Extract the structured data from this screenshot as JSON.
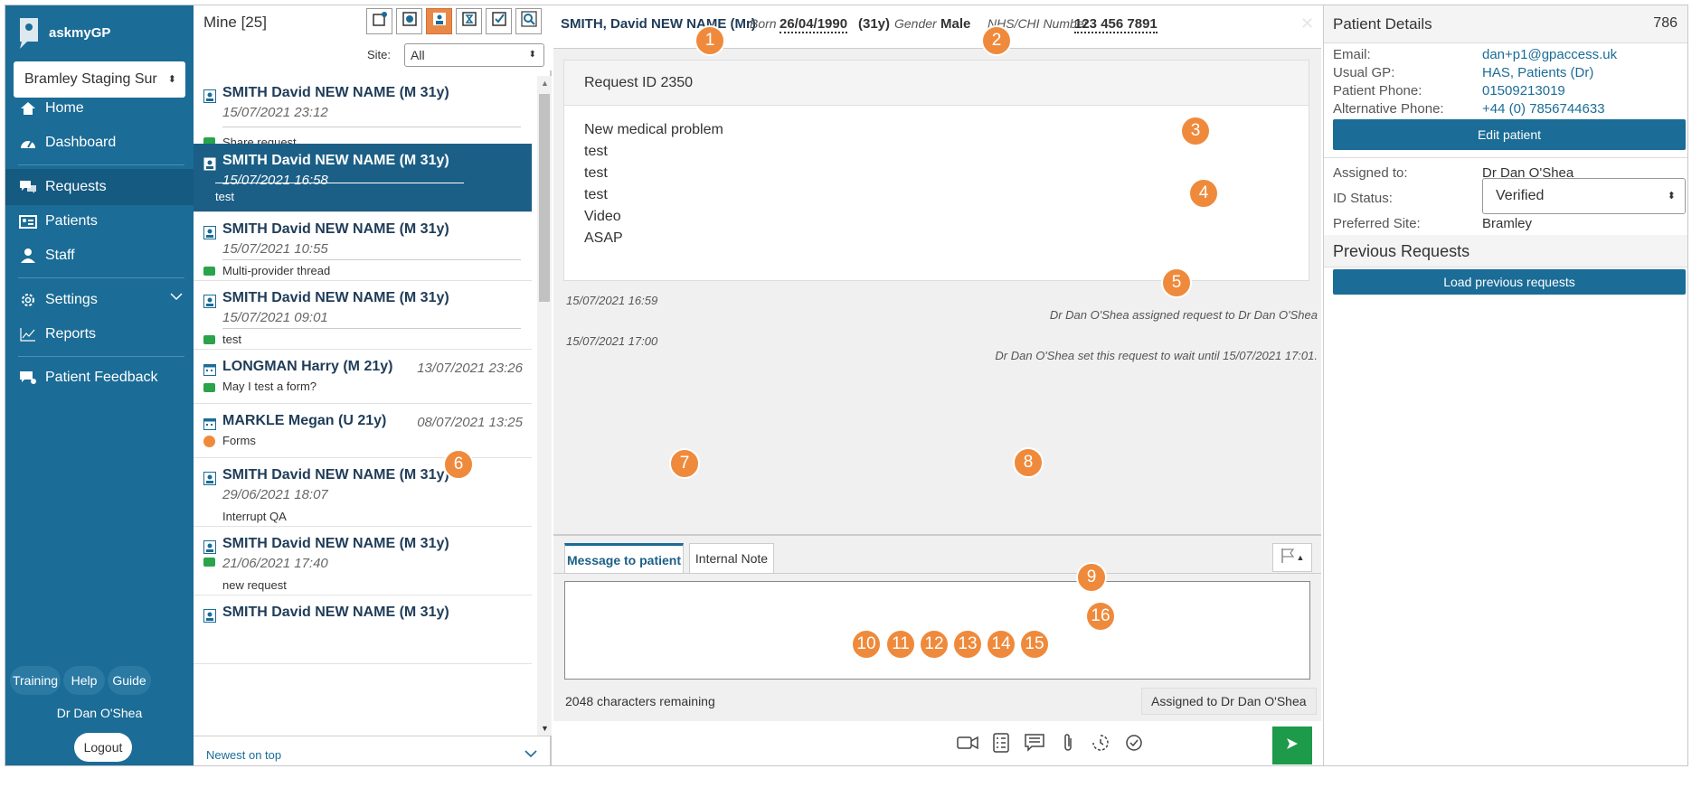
{
  "sidebar": {
    "app_name": "askmyGP",
    "org": "Bramley Staging Sur",
    "nav": {
      "home": "Home",
      "dashboard": "Dashboard",
      "requests": "Requests",
      "patients": "Patients",
      "staff": "Staff",
      "settings": "Settings",
      "reports": "Reports",
      "feedback": "Patient Feedback"
    },
    "training": "Training",
    "help": "Help",
    "guide": "Guide",
    "user": "Dr Dan O'Shea",
    "logout": "Logout"
  },
  "list": {
    "title": "Mine [25]",
    "site_label": "Site:",
    "site_value": "All",
    "items": [
      {
        "name": "SMITH David NEW NAME (M 31y)",
        "date": "15/07/2021 23:12",
        "snippet": "Share request"
      },
      {
        "name": "SMITH David NEW NAME (M 31y)",
        "date": "15/07/2021 16:58",
        "snippet": "test"
      },
      {
        "name": "SMITH David NEW NAME (M 31y)",
        "date": "15/07/2021 10:55",
        "snippet": "Multi-provider thread"
      },
      {
        "name": "SMITH David NEW NAME (M 31y)",
        "date": "15/07/2021 09:01",
        "snippet": "test"
      },
      {
        "name": "LONGMAN Harry (M 21y)",
        "date": "13/07/2021 23:26",
        "snippet": "May I test a form?"
      },
      {
        "name": "MARKLE Megan (U 21y)",
        "date": "08/07/2021 13:25",
        "snippet": "Forms"
      },
      {
        "name": "SMITH David NEW NAME (M 31y)",
        "date": "29/06/2021 18:07",
        "snippet": "Interrupt QA"
      },
      {
        "name": "SMITH David NEW NAME (M 31y)",
        "date": "21/06/2021 17:40",
        "snippet": "new request"
      },
      {
        "name": "SMITH David NEW NAME (M 31y)",
        "date": "",
        "snippet": ""
      }
    ],
    "sort": "Newest on top"
  },
  "patient": {
    "name": "SMITH, David NEW NAME (Mr)",
    "born_label": "Born",
    "born": "26/04/1990",
    "age": "(31y)",
    "gender_label": "Gender",
    "gender": "Male",
    "nhs_label": "NHS/CHI Number",
    "nhs": "123 456 7891"
  },
  "request": {
    "id": "Request ID 2350",
    "lines": [
      "New medical problem",
      "test",
      "test",
      "test",
      "Video",
      "ASAP"
    ],
    "log": [
      {
        "time": "15/07/2021 16:59",
        "text": "Dr Dan O'Shea assigned request to Dr Dan O'Shea"
      },
      {
        "time": "15/07/2021 17:00",
        "text": "Dr Dan O'Shea set this request to wait until 15/07/2021 17:01."
      }
    ]
  },
  "compose": {
    "tab_message": "Message to patient",
    "tab_note": "Internal Note",
    "remaining": "2048 characters remaining",
    "assigned": "Assigned to Dr Dan O'Shea"
  },
  "details": {
    "title": "Patient Details",
    "count": "786",
    "email_label": "Email:",
    "email": "dan+p1@gpaccess.uk",
    "gp_label": "Usual GP:",
    "gp": "HAS, Patients (Dr)",
    "phone_label": "Patient Phone:",
    "phone": "01509213019",
    "alt_label": "Alternative Phone:",
    "alt": "+44 (0) 7856744633",
    "edit": "Edit patient",
    "assigned_label": "Assigned to:",
    "assigned": "Dr Dan O'Shea",
    "id_label": "ID Status:",
    "id_status": "Verified",
    "site_label": "Preferred Site:",
    "site": "Bramley",
    "prev_title": "Previous Requests",
    "load_prev": "Load previous requests"
  },
  "badges": [
    "1",
    "2",
    "3",
    "4",
    "5",
    "6",
    "7",
    "8",
    "9",
    "10",
    "11",
    "12",
    "13",
    "14",
    "15",
    "16"
  ],
  "colors": {
    "brand": "#1b6c96",
    "accent": "#ef8a3c",
    "send": "#1d9a4a"
  }
}
